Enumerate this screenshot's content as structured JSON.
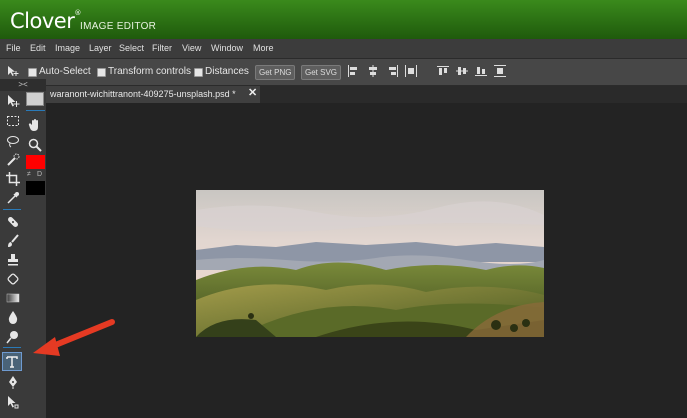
{
  "app": {
    "logo": "Clover",
    "trademark": "®",
    "subtitle": "IMAGE EDITOR"
  },
  "menu": [
    "File",
    "Edit",
    "Image",
    "Layer",
    "Select",
    "Filter",
    "View",
    "Window",
    "More"
  ],
  "options": {
    "auto_select": "Auto-Select",
    "transform_controls": "Transform controls",
    "distances": "Distances",
    "get_png": "Get PNG",
    "get_svg": "Get SVG"
  },
  "document": {
    "tab_title": "waranont-wichittranont-409275-unsplash.psd *",
    "close_glyph": "✕"
  },
  "toolbar": {
    "toggle": "><",
    "swap_label": "≠",
    "default_label": "D"
  },
  "colors": {
    "foreground": "#ff0000",
    "background": "#000000",
    "accent": "#2a7ab8",
    "header_green": "#2f7a16",
    "annotation_arrow": "#e53a23"
  },
  "tools": [
    "move-tool",
    "marquee-tool",
    "lasso-tool",
    "quick-select-tool",
    "crop-tool",
    "eyedropper-tool",
    "healing-tool",
    "brush-tool",
    "stamp-tool",
    "eraser-tool",
    "gradient-tool",
    "blur-tool",
    "dodge-tool",
    "text-tool",
    "pen-tool",
    "path-select-tool",
    "hand-tool",
    "zoom-tool"
  ],
  "active_tool": "text-tool"
}
